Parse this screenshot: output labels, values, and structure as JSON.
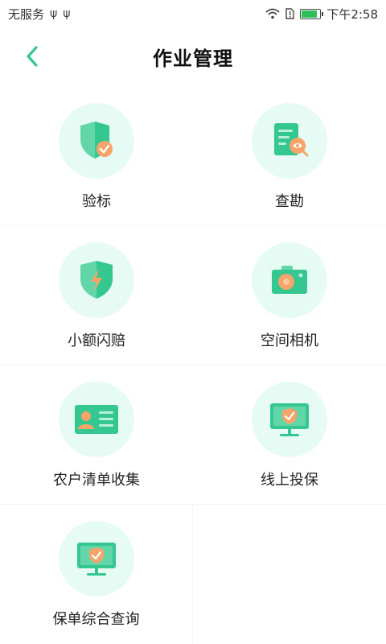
{
  "status_bar": {
    "carrier": "无服务",
    "usb_glyph": "ψ",
    "time": "下午2:58"
  },
  "header": {
    "title": "作业管理"
  },
  "colors": {
    "accent": "#35c790",
    "icon_bg": "#e6fbf3",
    "orange": "#f6a46b"
  },
  "menu": [
    {
      "label": "验标",
      "icon": "shield-check-icon"
    },
    {
      "label": "查勘",
      "icon": "document-inspect-icon"
    },
    {
      "label": "小额闪赔",
      "icon": "shield-flash-icon"
    },
    {
      "label": "空间相机",
      "icon": "camera-icon"
    },
    {
      "label": "农户清单收集",
      "icon": "id-card-icon"
    },
    {
      "label": "线上投保",
      "icon": "monitor-check-icon"
    },
    {
      "label": "保单综合查询",
      "icon": "monitor-check-icon"
    }
  ]
}
